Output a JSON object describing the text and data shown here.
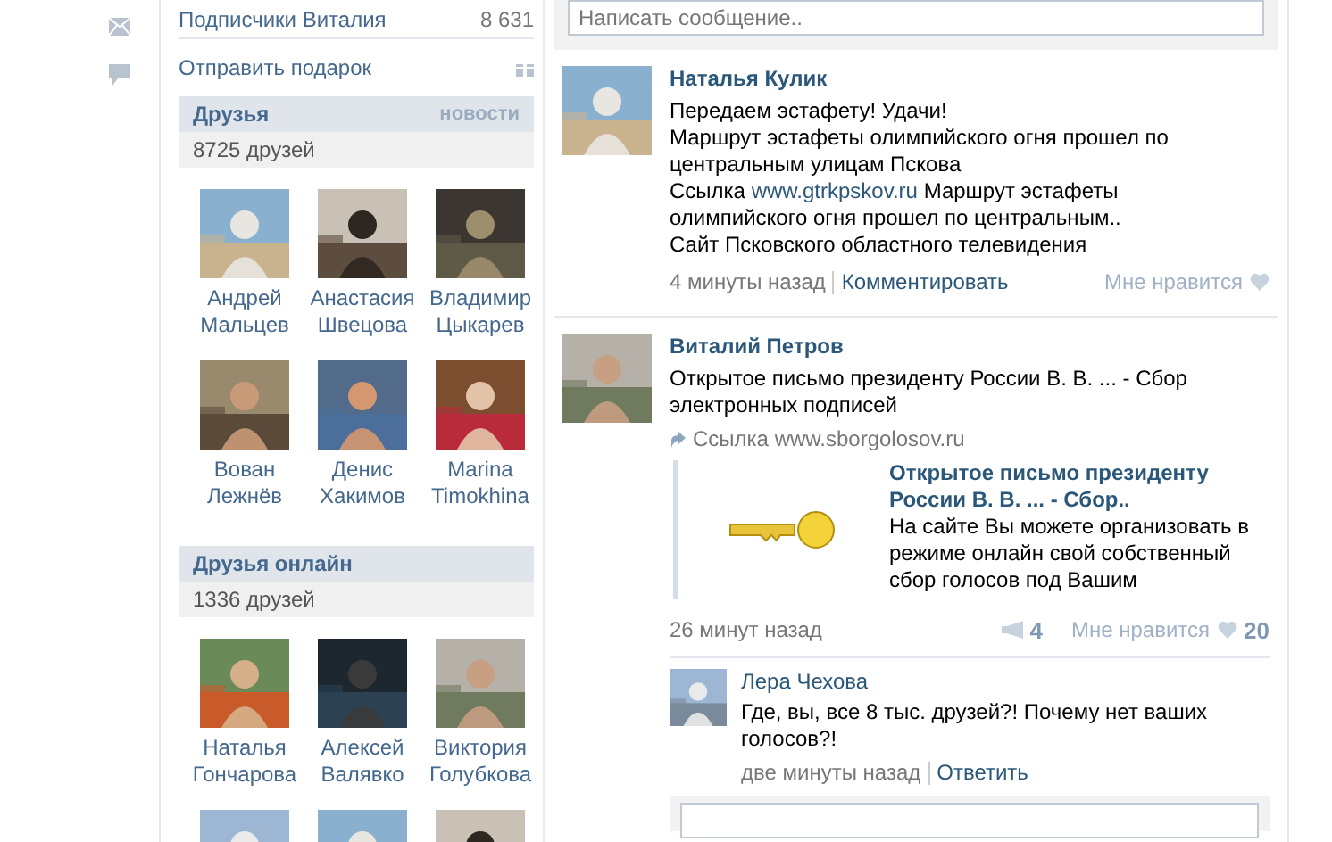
{
  "subscribers": {
    "label": "Подписчики Виталия",
    "count": "8 631"
  },
  "gift_link": "Отправить подарок",
  "friends": {
    "title": "Друзья",
    "link": "новости",
    "count": "8725 друзей",
    "people": [
      {
        "name": "Андрей Мальцев"
      },
      {
        "name": "Анастасия Швецова"
      },
      {
        "name": "Владимир Цыкарев"
      },
      {
        "name": "Вован Лежнёв"
      },
      {
        "name": "Денис Хакимов"
      },
      {
        "name": "Marina Timokhina"
      }
    ]
  },
  "online_friends": {
    "title": "Друзья онлайн",
    "count": "1336 друзей",
    "people": [
      {
        "name": "Наталья Гончарова"
      },
      {
        "name": "Алексей Валявко"
      },
      {
        "name": "Виктория Голубкова"
      },
      {
        "kind": "picture"
      },
      {
        "kind": "picture"
      },
      {
        "kind": "picture"
      }
    ]
  },
  "message_field": {
    "placeholder": "Написать сообщение.."
  },
  "posts": [
    {
      "author": "Наталья Кулик",
      "lines": [
        "Передаем эстафету! Удачи!",
        "Маршрут эстафеты олимпийского огня прошел по центральным улицам Пскова"
      ],
      "link_prefix": "Ссылка",
      "link_url": "www.gtrkpskov.ru",
      "link_text": "Маршрут эстафеты олимпийского огня прошел по центральным..",
      "site_line": "Сайт Псковского областного телевидения",
      "time": "4 минуты назад",
      "action": "Комментировать",
      "like_label": "Мне нравится"
    },
    {
      "author": "Виталий Петров",
      "lines": [
        "Открытое письмо президенту России В. В. ... - Сбор электронных подписей"
      ],
      "attachment": "Ссылка www.sborgolosov.ru",
      "preview": {
        "title": "Открытое письмо президенту России В. В. ... - Сбор..",
        "description": "На сайте Вы можете организовать в режиме онлайн свой собственный сбор голосов под Вашим"
      },
      "time": "26 минут назад",
      "shares": "4",
      "like_label": "Мне нравится",
      "likes": "20",
      "comment": {
        "author": "Лера Чехова",
        "text": "Где, вы, все 8 тыс. друзей?! Почему нет ваших голосов?!",
        "time": "две минуты назад",
        "action": "Ответить"
      }
    }
  ]
}
